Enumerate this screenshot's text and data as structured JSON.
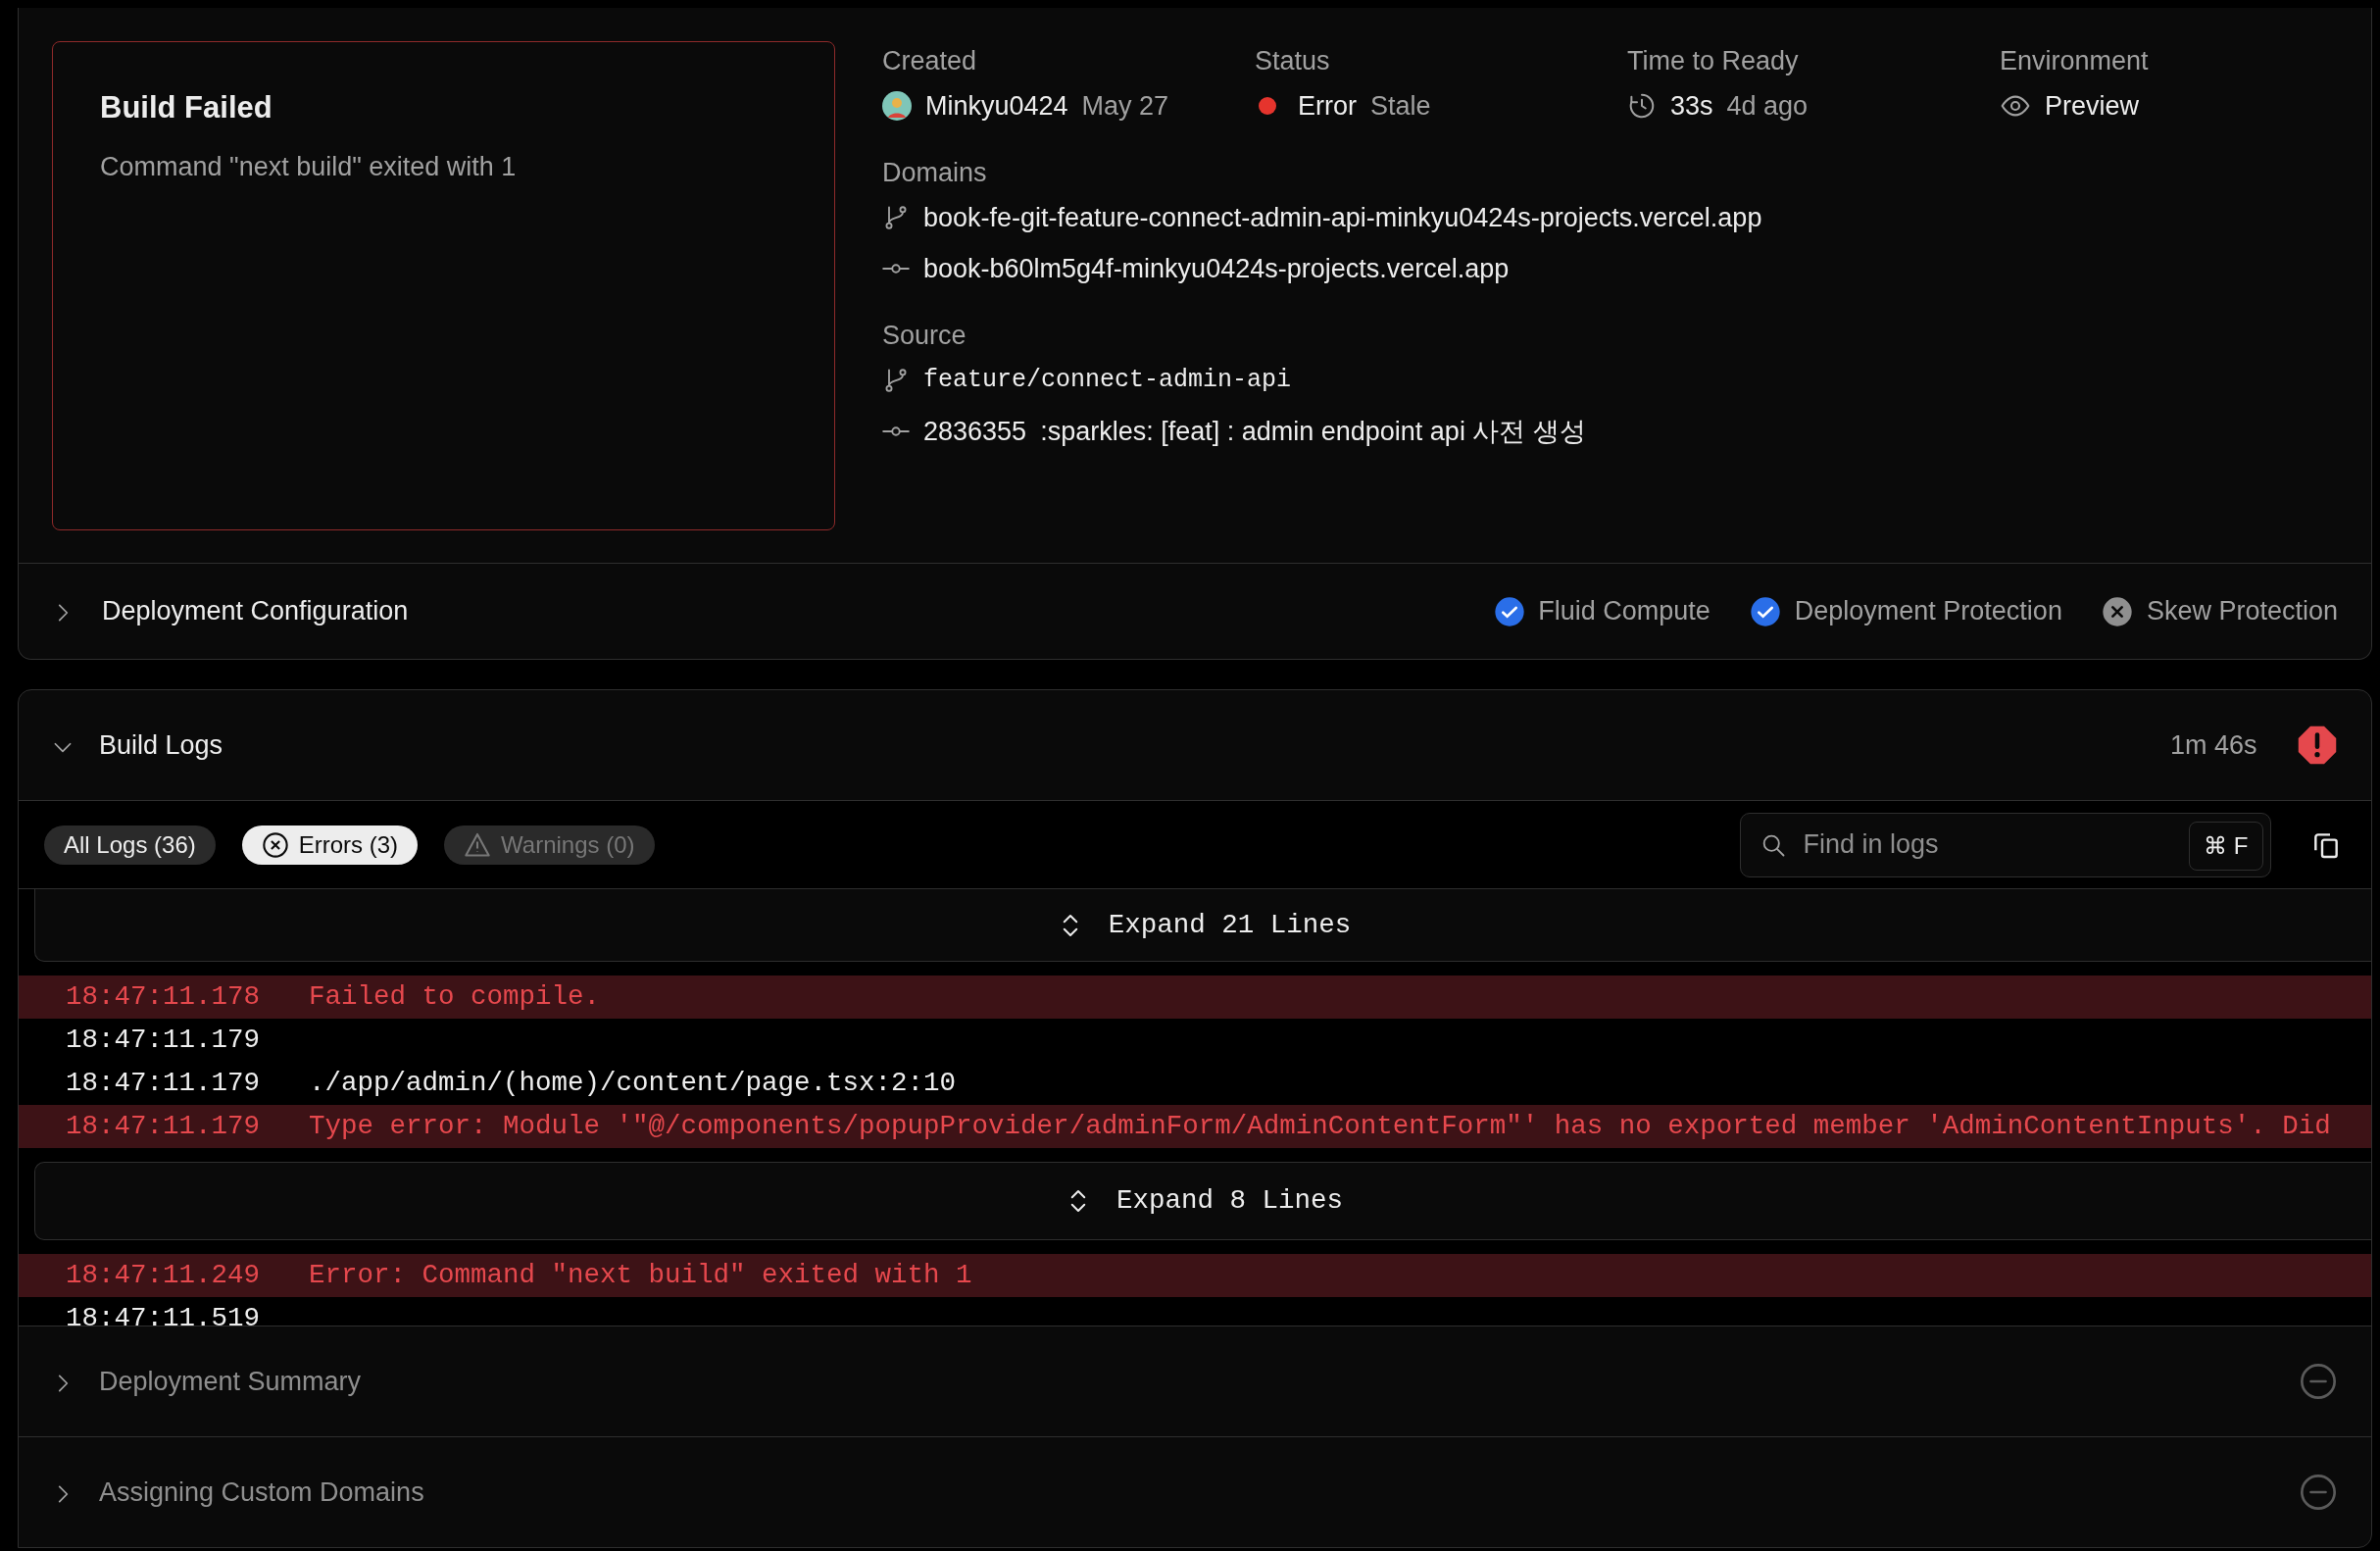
{
  "preview": {
    "title": "Build Failed",
    "message": "Command \"next build\" exited with 1"
  },
  "meta": [
    {
      "kind": "created",
      "label": "Created",
      "value": "Minkyu0424",
      "note": "May 27"
    },
    {
      "kind": "status",
      "label": "Status",
      "value": "Error",
      "note": "Stale",
      "failed": true
    },
    {
      "kind": "time",
      "label": "Time to Ready",
      "value": "33s",
      "note": "4d ago"
    },
    {
      "kind": "environment",
      "label": "Environment",
      "value": "Preview"
    }
  ],
  "domains": {
    "label": "Domains",
    "items": [
      {
        "kind": "branch",
        "text": "book-fe-git-feature-connect-admin-api-minkyu0424s-projects.vercel.app"
      },
      {
        "kind": "commit",
        "text": "book-b60lm5g4f-minkyu0424s-projects.vercel.app"
      }
    ]
  },
  "source": {
    "label": "Source",
    "items": [
      {
        "kind": "branch",
        "text": "feature/connect-admin-api",
        "monospace": true
      },
      {
        "kind": "commit",
        "sha": "2836355",
        "text": ":sparkles: [feat] : admin endpoint api 사전 생성"
      }
    ]
  },
  "configuration": {
    "title": "Deployment Configuration",
    "expanded": false,
    "features": [
      {
        "label": "Fluid Compute",
        "enabled": true
      },
      {
        "label": "Deployment Protection",
        "enabled": true
      },
      {
        "label": "Skew Protection",
        "enabled": false
      }
    ]
  },
  "build_logs": {
    "title": "Build Logs",
    "expanded": true,
    "duration": "1m 46s",
    "failed": true,
    "filters": [
      {
        "kind": "all",
        "label": "All Logs (36)",
        "selected": false,
        "disabled": false
      },
      {
        "kind": "errors",
        "label": "Errors (3)",
        "selected": true,
        "disabled": false
      },
      {
        "kind": "warnings",
        "label": "Warnings (0)",
        "selected": false,
        "disabled": true
      }
    ],
    "search": {
      "placeholder": "Find in logs",
      "shortcut": "⌘ F"
    },
    "lines": [
      {
        "kind": "expand",
        "text": "Expand 21 Lines"
      },
      {
        "kind": "log",
        "error": true,
        "time": "18:47:11.178",
        "text": "Failed to compile."
      },
      {
        "kind": "log",
        "error": false,
        "time": "18:47:11.179"
      },
      {
        "kind": "log",
        "error": false,
        "time": "18:47:11.179",
        "text": "./app/admin/(home)/content/page.tsx:2:10"
      },
      {
        "kind": "log",
        "error": true,
        "time": "18:47:11.179",
        "text": "Type error: Module '\"@/components/popupProvider/adminForm/AdminContentForm\"' has no exported member 'AdminContentInputs'. Did"
      },
      {
        "kind": "expand",
        "text": "Expand 8 Lines"
      },
      {
        "kind": "log",
        "error": true,
        "time": "18:47:11.249",
        "text": "Error: Command \"next build\" exited with 1"
      },
      {
        "kind": "log",
        "error": false,
        "time": "18:47:11.519"
      }
    ]
  },
  "steps": [
    {
      "title": "Deployment Summary",
      "expanded": false,
      "disabled": true
    },
    {
      "title": "Assigning Custom Domains",
      "expanded": false,
      "disabled": true
    }
  ]
}
